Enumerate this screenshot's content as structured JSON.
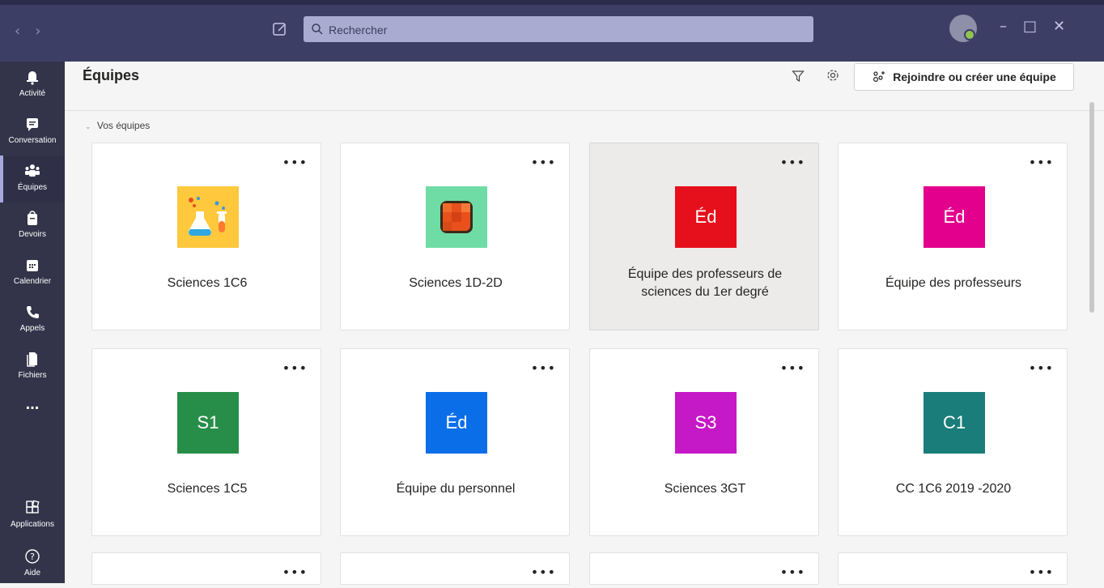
{
  "topbar": {
    "search_placeholder": "Rechercher"
  },
  "rail": {
    "items": [
      {
        "label": "Activité",
        "icon": "bell-icon"
      },
      {
        "label": "Conversation",
        "icon": "chat-icon"
      },
      {
        "label": "Équipes",
        "icon": "teams-icon",
        "active": true
      },
      {
        "label": "Devoirs",
        "icon": "assignments-icon"
      },
      {
        "label": "Calendrier",
        "icon": "calendar-icon"
      },
      {
        "label": "Appels",
        "icon": "phone-icon"
      },
      {
        "label": "Fichiers",
        "icon": "files-icon"
      },
      {
        "label": "...",
        "icon": "more-icon"
      }
    ],
    "bottom": [
      {
        "label": "Applications",
        "icon": "apps-icon"
      },
      {
        "label": "Aide",
        "icon": "help-icon"
      }
    ]
  },
  "header": {
    "title": "Équipes",
    "join_button": "Rejoindre ou créer une équipe"
  },
  "section_label": "Vos équipes",
  "teams": [
    {
      "name": "Sciences 1C6",
      "tile": "",
      "tile_color": "#ffc83d",
      "icon": "science-icon"
    },
    {
      "name": "Sciences 1D-2D",
      "tile": "",
      "tile_color": "#6fdca6",
      "icon": "square-grid-icon"
    },
    {
      "name": "Équipe des professeurs de sciences du 1er degré",
      "tile": "Éd",
      "tile_color": "#e60f1c"
    },
    {
      "name": "Équipe des professeurs",
      "tile": "Éd",
      "tile_color": "#e3008c"
    },
    {
      "name": "Sciences 1C5",
      "tile": "S1",
      "tile_color": "#278e4a"
    },
    {
      "name": "Équipe du personnel",
      "tile": "Éd",
      "tile_color": "#0a6ee8"
    },
    {
      "name": "Sciences 3GT",
      "tile": "S3",
      "tile_color": "#c518c6"
    },
    {
      "name": "CC 1C6 2019 -2020",
      "tile": "C1",
      "tile_color": "#1a7d79"
    }
  ],
  "more_label": "•••"
}
